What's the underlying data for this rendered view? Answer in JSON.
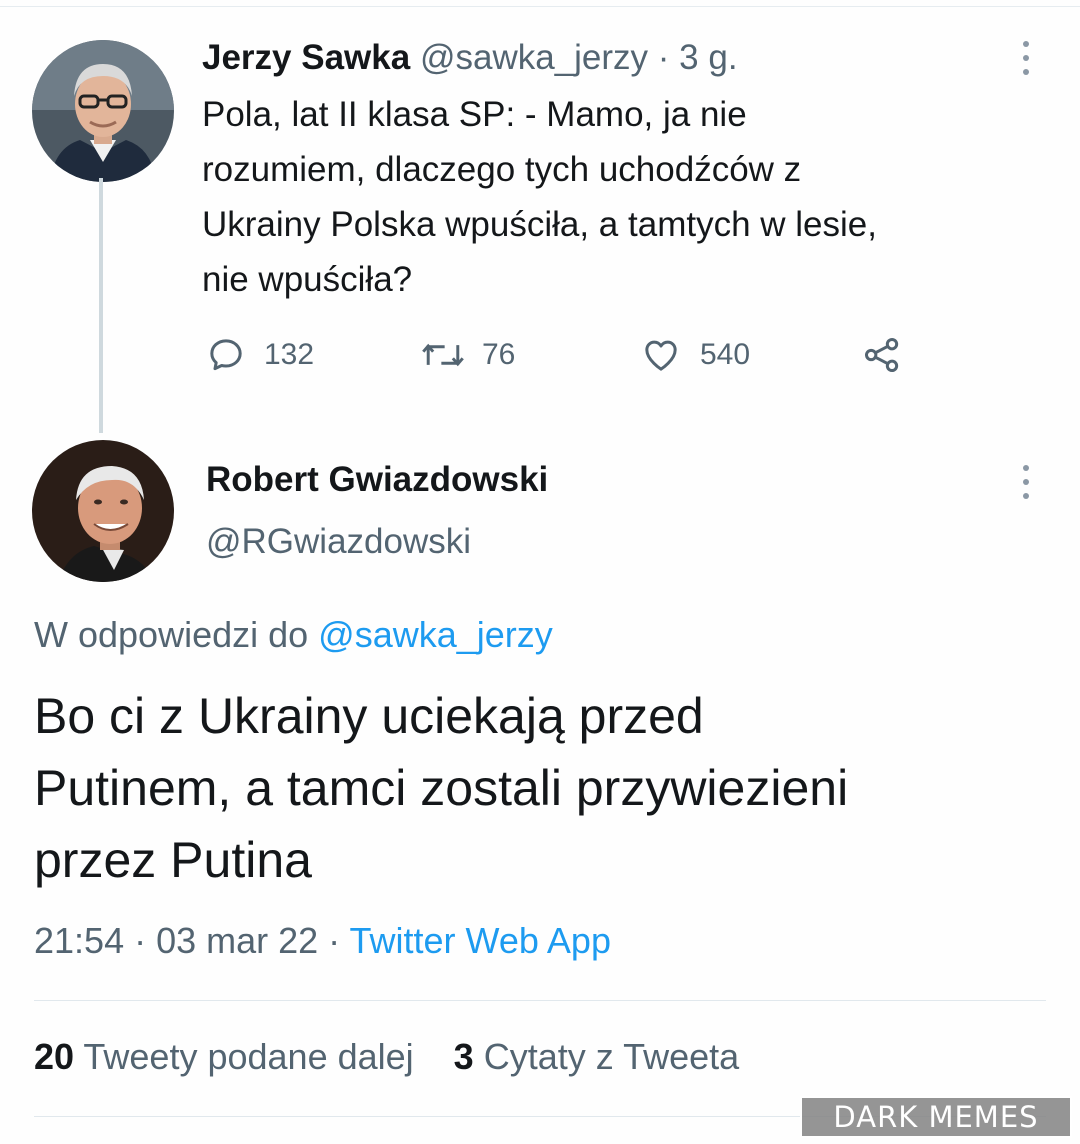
{
  "tweet": {
    "author_name": "Jerzy Sawka",
    "author_handle": "@sawka_jerzy",
    "time_ago": "· 3 g.",
    "lines": [
      "Pola, lat II klasa SP: - Mamo, ja nie",
      "rozumiem, dlaczego tych uchodźców z",
      "Ukrainy Polska wpuściła, a tamtych w lesie,",
      "nie wpuściła?"
    ],
    "replies": "132",
    "retweets": "76",
    "likes": "540"
  },
  "reply": {
    "author_name": "Robert Gwiazdowski",
    "author_handle": "@RGwiazdowski",
    "reply_prefix": "W odpowiedzi do",
    "reply_mention": "@sawka_jerzy",
    "lines": [
      "Bo ci z Ukrainy uciekają przed",
      "Putinem, a tamci zostali przywiezieni",
      "przez Putina"
    ],
    "timestamp": "21:54 · 03 mar 22 · ",
    "source": "Twitter Web App",
    "retweet_count": "20",
    "retweet_label": "Tweety podane dalej",
    "quote_count": "3",
    "quote_label": "Cytaty z Tweeta"
  },
  "watermark": {
    "text": "DARK MEMES"
  },
  "icons": {
    "reply": "comment-icon",
    "retweet": "retweet-icon",
    "like": "heart-icon",
    "share": "share-icon",
    "more": "more-vertical-icon"
  },
  "colors": {
    "text": "#14171a",
    "secondary": "#536471",
    "link": "#1d9bf0",
    "line": "#cfd9de"
  }
}
